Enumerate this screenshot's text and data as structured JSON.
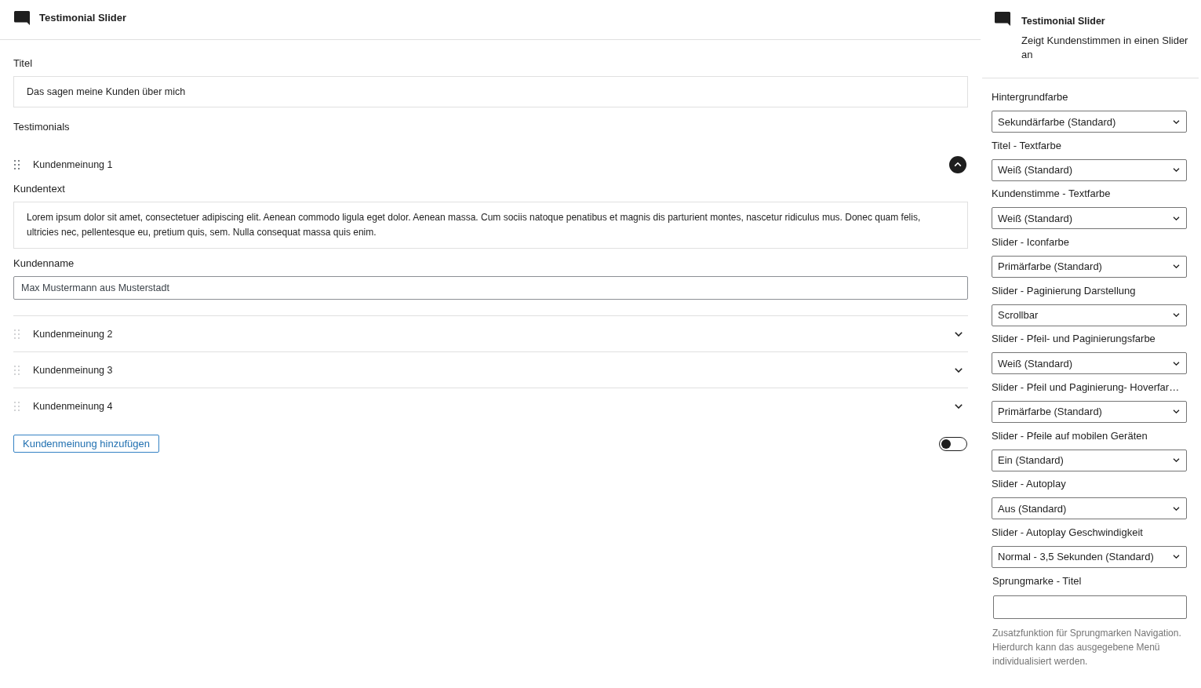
{
  "editor": {
    "block_title": "Testimonial Slider",
    "title_field": {
      "label": "Titel",
      "value": "Das sagen meine Kunden über mich"
    },
    "testimonials_label": "Testimonials",
    "testimonials": [
      {
        "heading": "Kundenmeinung 1",
        "expanded": true,
        "text_field": {
          "label": "Kundentext",
          "value": "Lorem ipsum dolor sit amet, consectetuer adipiscing elit. Aenean commodo ligula eget dolor. Aenean massa. Cum sociis natoque penatibus et magnis dis parturient montes, nascetur ridiculus mus. Donec quam felis, ultricies nec, pellentesque eu, pretium quis, sem. Nulla consequat massa quis enim."
        },
        "name_field": {
          "label": "Kundenname",
          "value": "Max Mustermann aus Musterstadt"
        }
      },
      {
        "heading": "Kundenmeinung 2",
        "expanded": false
      },
      {
        "heading": "Kundenmeinung 3",
        "expanded": false
      },
      {
        "heading": "Kundenmeinung 4",
        "expanded": false
      }
    ],
    "add_button": "Kundenmeinung hinzufügen",
    "toggle": {
      "on": false
    }
  },
  "sidebar": {
    "block_title": "Testimonial Slider",
    "description": "Zeigt Kundenstimmen in einen Slider an",
    "settings": [
      {
        "kind": "select",
        "label": "Hintergrundfarbe",
        "value": "Sekundärfarbe (Standard)"
      },
      {
        "kind": "select",
        "label": "Titel - Textfarbe",
        "value": "Weiß (Standard)"
      },
      {
        "kind": "select",
        "label": "Kundenstimme - Textfarbe",
        "value": "Weiß (Standard)"
      },
      {
        "kind": "select",
        "label": "Slider - Iconfarbe",
        "value": "Primärfarbe (Standard)"
      },
      {
        "kind": "select",
        "label": "Slider - Paginierung Darstellung",
        "value": "Scrollbar"
      },
      {
        "kind": "select",
        "label": "Slider - Pfeil- und Paginierungsfarbe",
        "value": "Weiß (Standard)"
      },
      {
        "kind": "select",
        "label": "Slider - Pfeil und Paginierung- Hoverfar…",
        "value": "Primärfarbe (Standard)"
      },
      {
        "kind": "select",
        "label": "Slider - Pfeile auf mobilen Geräten",
        "value": "Ein (Standard)"
      },
      {
        "kind": "select",
        "label": "Slider - Autoplay",
        "value": "Aus (Standard)"
      },
      {
        "kind": "select",
        "label": "Slider - Autoplay Geschwindigkeit",
        "value": "Normal - 3,5 Sekunden (Standard)"
      },
      {
        "kind": "text",
        "label": "Sprungmarke - Titel",
        "help": "Zusatzfunktion für Sprungmarken Navigation. Hierdurch kann das ausgegebene Menü individualisiert werden."
      }
    ]
  }
}
